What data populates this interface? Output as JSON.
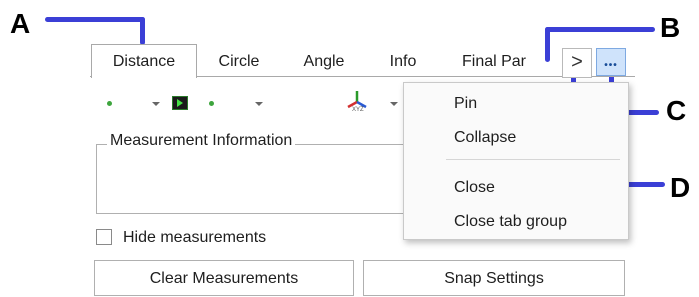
{
  "callouts": {
    "a": "A",
    "b": "B",
    "c": "C",
    "d": "D"
  },
  "tabs": [
    "Distance",
    "Circle",
    "Angle",
    "Info",
    "Final Par"
  ],
  "chevron_glyph": ">",
  "more_glyph": "•••",
  "measurement_group_label": "Measurement Information",
  "hide_measurements_label": "Hide measurements",
  "buttons": {
    "clear": "Clear Measurements",
    "snap": "Snap Settings"
  },
  "axis_icon_label": "XYZ",
  "menu": {
    "items": [
      "Pin",
      "Collapse",
      "Close",
      "Close tab group"
    ]
  },
  "colors": {
    "callout_line": "#3b3fd6",
    "more_button_bg": "#cfe3fb",
    "dot": "#3ea53e"
  }
}
